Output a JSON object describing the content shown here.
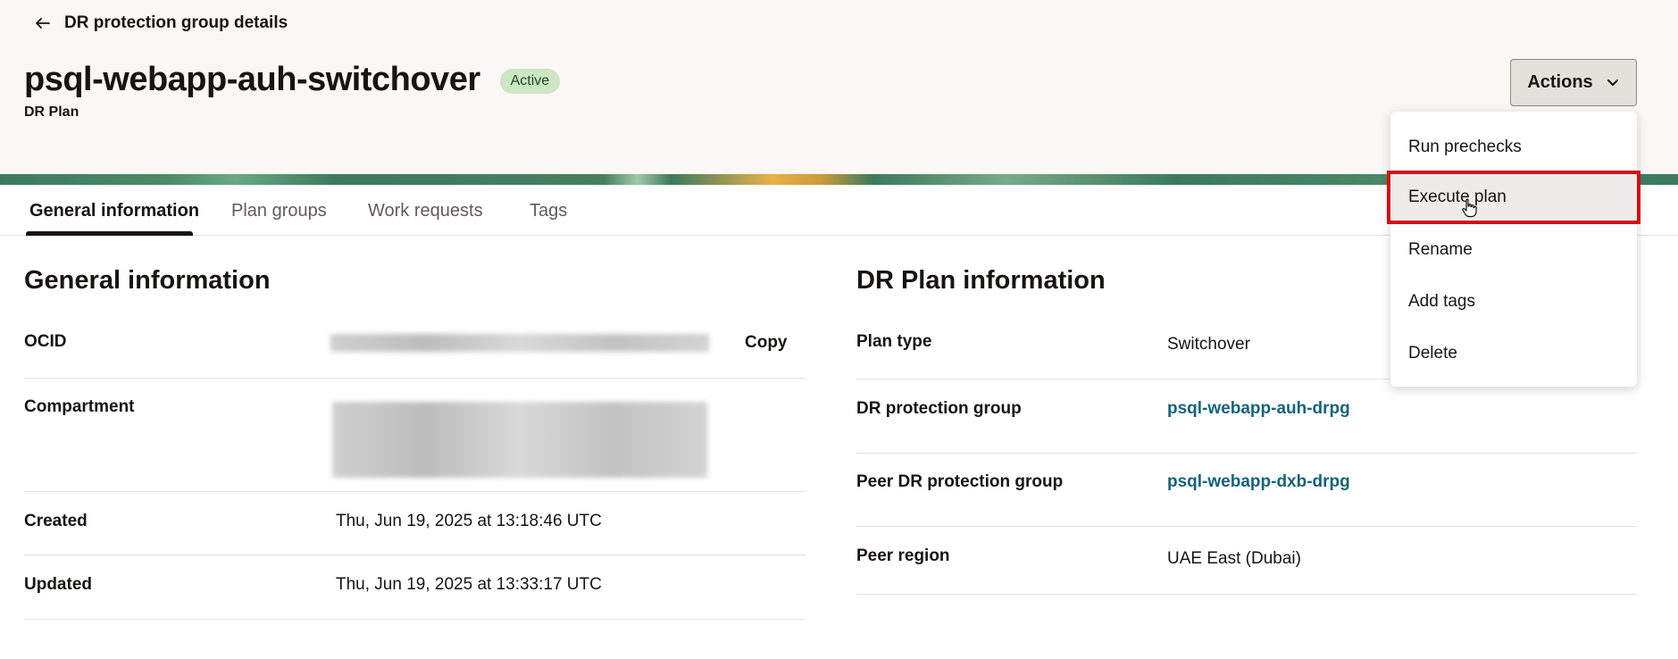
{
  "header": {
    "back_label": "DR protection group details",
    "title": "psql-webapp-auh-switchover",
    "status": "Active",
    "subtitle": "DR Plan",
    "actions_label": "Actions"
  },
  "actions_menu": {
    "items": [
      {
        "label": "Run prechecks"
      },
      {
        "label": "Execute plan",
        "highlighted": true
      },
      {
        "label": "Rename"
      },
      {
        "label": "Add tags"
      },
      {
        "label": "Delete"
      }
    ]
  },
  "tabs": [
    {
      "label": "General information",
      "active": true
    },
    {
      "label": "Plan groups"
    },
    {
      "label": "Work requests"
    },
    {
      "label": "Tags"
    }
  ],
  "general_info": {
    "title": "General information",
    "ocid_label": "OCID",
    "copy_label": "Copy",
    "compartment_label": "Compartment",
    "created_label": "Created",
    "created_value": "Thu, Jun 19, 2025 at 13:18:46 UTC",
    "updated_label": "Updated",
    "updated_value": "Thu, Jun 19, 2025 at 13:33:17 UTC"
  },
  "plan_info": {
    "title": "DR Plan information",
    "plan_type_label": "Plan type",
    "plan_type_value": "Switchover",
    "protection_group_label": "DR protection group",
    "protection_group_value": "psql-webapp-auh-drpg",
    "peer_group_label": "Peer DR protection group",
    "peer_group_value": "psql-webapp-dxb-drpg",
    "peer_region_label": "Peer region",
    "peer_region_value": "UAE East (Dubai)"
  },
  "colors": {
    "highlight_border": "#d40f15",
    "link": "#16637a",
    "badge_bg": "#cde6c4"
  }
}
